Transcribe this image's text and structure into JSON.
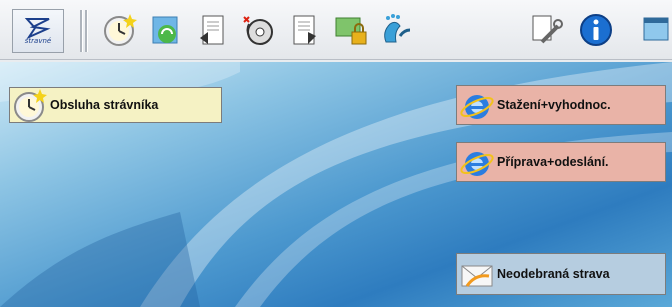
{
  "toolbar": {
    "logo_label": "stravné",
    "buttons": [
      {
        "icon": "clock-icon"
      },
      {
        "icon": "refresh-icon"
      },
      {
        "icon": "document-export-icon"
      },
      {
        "icon": "disc-icon"
      },
      {
        "icon": "document-import-icon"
      },
      {
        "icon": "lock-computer-icon"
      },
      {
        "icon": "footprints-icon"
      },
      {
        "icon": "tools-icon"
      },
      {
        "icon": "info-icon"
      },
      {
        "icon": "window-icon"
      }
    ]
  },
  "desktop": {
    "shortcuts": [
      {
        "label": "Obsluha strávníka",
        "icon": "clock-icon"
      },
      {
        "label": "Stažení+vyhodnoc.",
        "icon": "internet-explorer-icon"
      },
      {
        "label": "Příprava+odeslání.",
        "icon": "internet-explorer-icon"
      },
      {
        "label": "Neodebraná strava",
        "icon": "envelope-icon"
      }
    ]
  },
  "colors": {
    "left_shortcut_bg": "#f5f2c4",
    "ie_shortcut_bg": "#e9b3a7",
    "mail_shortcut_bg": "#b6cde0",
    "desktop_blue": "#2e7cbf"
  }
}
